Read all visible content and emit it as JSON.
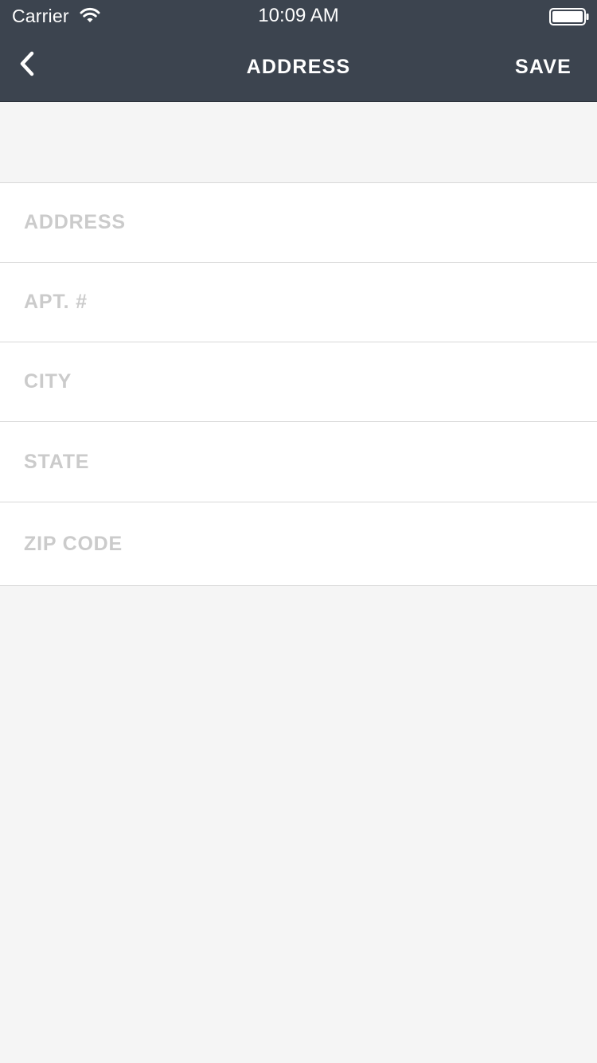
{
  "status_bar": {
    "carrier": "Carrier",
    "time": "10:09 AM",
    "wifi_icon": "wifi-icon",
    "battery_icon": "battery-full-icon"
  },
  "nav": {
    "back_icon": "chevron-left-icon",
    "title": "ADDRESS",
    "save_label": "SAVE"
  },
  "form": {
    "fields": [
      {
        "name": "address",
        "placeholder": "ADDRESS",
        "value": ""
      },
      {
        "name": "apt",
        "placeholder": "APT. #",
        "value": ""
      },
      {
        "name": "city",
        "placeholder": "CITY",
        "value": ""
      },
      {
        "name": "state",
        "placeholder": "STATE",
        "value": ""
      },
      {
        "name": "zip",
        "placeholder": "ZIP CODE",
        "value": ""
      }
    ]
  },
  "colors": {
    "header_bg": "#3c444f",
    "page_bg": "#f5f5f5",
    "placeholder": "#cbcbcb",
    "divider": "#d8d8d8"
  }
}
